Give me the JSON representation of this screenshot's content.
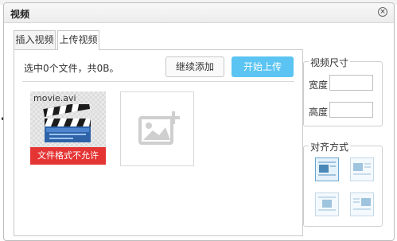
{
  "dialog": {
    "title": "视频",
    "close_glyph": "×"
  },
  "tabs": [
    {
      "label": "插入视频",
      "active": false
    },
    {
      "label": "上传视频",
      "active": true
    }
  ],
  "upload": {
    "status": "选中0个文件，共0B。",
    "continue_label": "继续添加",
    "start_label": "开始上传",
    "accent": "#5bc4f2"
  },
  "files": [
    {
      "name": "movie.avi",
      "error": "文件格式不允许",
      "icon": "clapperboard-icon"
    }
  ],
  "add_tile": {
    "icon": "add-image-icon"
  },
  "video_size": {
    "legend": "视频尺寸",
    "width_label": "宽度",
    "height_label": "高度",
    "width_value": "",
    "height_value": ""
  },
  "alignment": {
    "legend": "对齐方式",
    "options": [
      {
        "icon": "align-none-icon",
        "selected": true
      },
      {
        "icon": "align-left-icon",
        "selected": false
      },
      {
        "icon": "align-center-icon",
        "selected": false
      },
      {
        "icon": "align-right-icon",
        "selected": false
      }
    ]
  },
  "colors": {
    "error": "#e53434",
    "primary_button": "#5bc4f2"
  }
}
